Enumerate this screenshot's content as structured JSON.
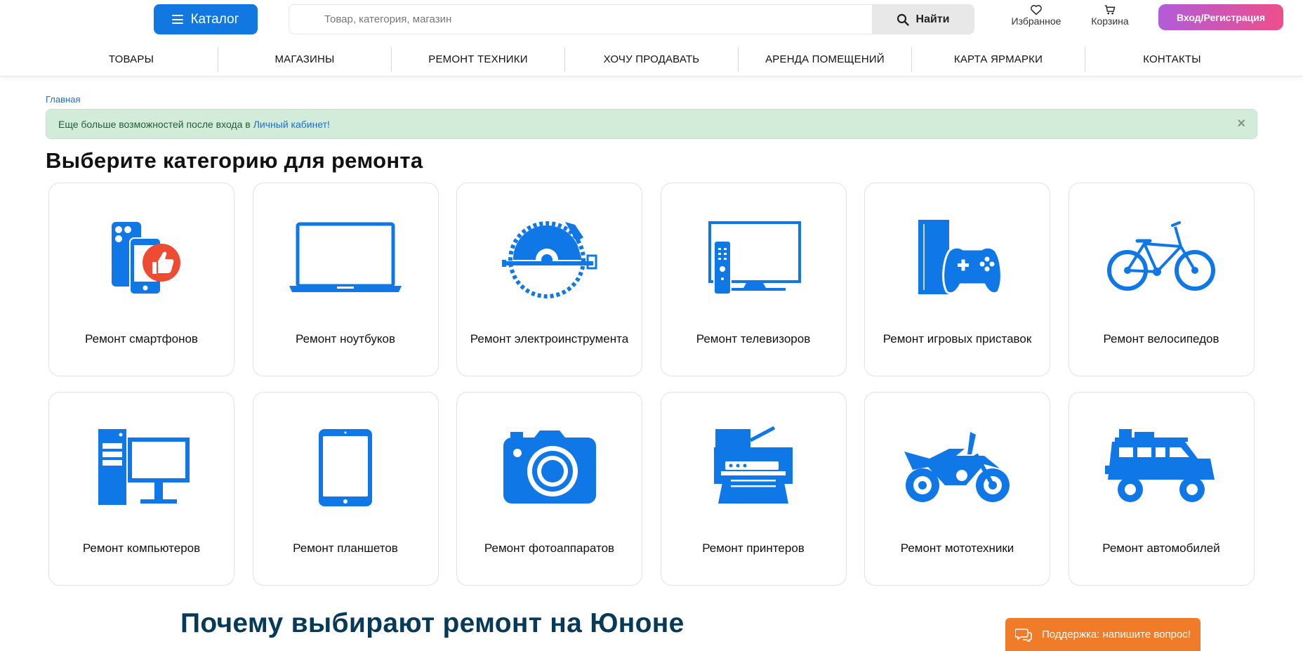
{
  "header": {
    "catalog_label": "Каталог",
    "search_placeholder": "Товар, категория, магазин",
    "search_button": "Найти",
    "favorites_label": "Избранное",
    "cart_label": "Корзина",
    "login_label": "Вход/Регистрация"
  },
  "nav": {
    "items": [
      "ТОВАРЫ",
      "МАГАЗИНЫ",
      "РЕМОНТ ТЕХНИКИ",
      "ХОЧУ ПРОДАВАТЬ",
      "АРЕНДА ПОМЕЩЕНИЙ",
      "КАРТА ЯРМАРКИ",
      "КОНТАКТЫ"
    ]
  },
  "breadcrumb": {
    "home": "Главная"
  },
  "alert": {
    "text": "Еще больше возможностей после входа в",
    "link": "Личный кабинет!",
    "close": "×"
  },
  "title": "Выберите категорию для ремонта",
  "categories": [
    {
      "label": "Ремонт смартфонов",
      "icon": "smartphone-icon"
    },
    {
      "label": "Ремонт ноутбуков",
      "icon": "laptop-icon"
    },
    {
      "label": "Ремонт электроинструмента",
      "icon": "circular-saw-icon"
    },
    {
      "label": "Ремонт телевизоров",
      "icon": "tv-icon"
    },
    {
      "label": "Ремонт игровых приставок",
      "icon": "game-console-icon"
    },
    {
      "label": "Ремонт велосипедов",
      "icon": "bicycle-icon"
    },
    {
      "label": "Ремонт компьютеров",
      "icon": "computer-icon"
    },
    {
      "label": "Ремонт планшетов",
      "icon": "tablet-icon"
    },
    {
      "label": "Ремонт фотоаппаратов",
      "icon": "camera-icon"
    },
    {
      "label": "Ремонт принтеров",
      "icon": "printer-icon"
    },
    {
      "label": "Ремонт мототехники",
      "icon": "motorcycle-icon"
    },
    {
      "label": "Ремонт автомобилей",
      "icon": "car-icon"
    }
  ],
  "why_title": "Почему выбирают ремонт на Юноне",
  "support": {
    "label": "Поддержка: напишите вопрос!"
  },
  "colors": {
    "accent": "#1178e2",
    "icon_blue": "#0f77e6",
    "support_orange": "#f07c2a",
    "why_title": "#073a58"
  }
}
